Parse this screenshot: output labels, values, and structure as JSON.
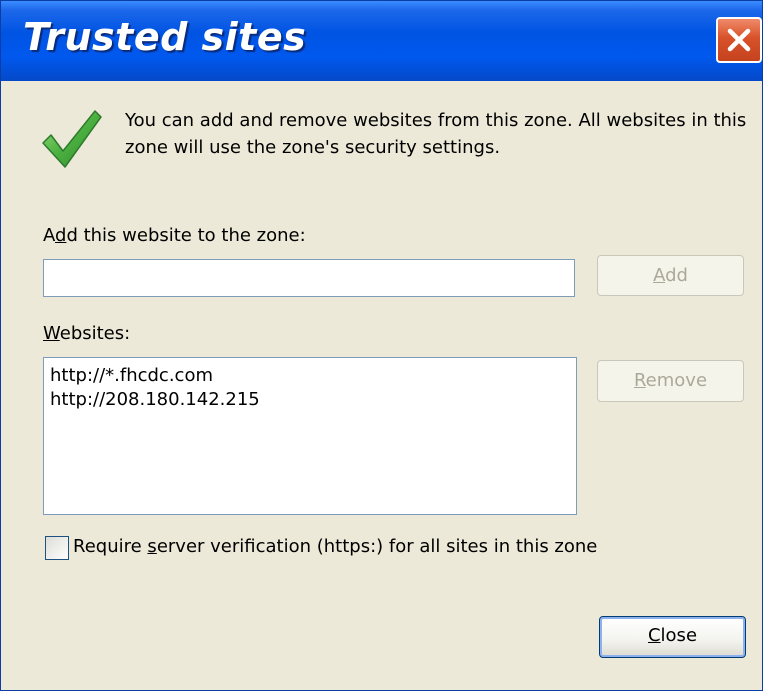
{
  "window": {
    "title": "Trusted sites"
  },
  "intro": {
    "text": "You can add and remove websites from this zone. All websites in this zone will use the zone's security settings."
  },
  "add_section": {
    "label_mnemonic": "d",
    "label_before": "A",
    "label_after": "d this website to the zone:",
    "input_value": "",
    "add_button": {
      "before": "",
      "mnemonic": "A",
      "after": "dd",
      "enabled": false
    }
  },
  "websites": {
    "label_before": "",
    "label_mnemonic": "W",
    "label_after": "ebsites:",
    "items": [
      "http://*.fhcdc.com",
      "http://208.180.142.215"
    ],
    "remove_button": {
      "before": "",
      "mnemonic": "R",
      "after": "emove",
      "enabled": false
    }
  },
  "verification": {
    "checked": false,
    "label_before": "Require ",
    "label_mnemonic": "s",
    "label_after": "erver verification (https:) for all sites in this zone"
  },
  "footer": {
    "close_button": {
      "before": "",
      "mnemonic": "C",
      "after": "lose"
    }
  },
  "colors": {
    "titlebar": "#0054e3",
    "dialog_bg": "#ece9d8",
    "close_x": "#d8522a",
    "check_icon": "#3fa03f",
    "disabled_text": "#aca899"
  },
  "icons": {
    "close": "close-icon",
    "intro": "checkmark-icon"
  }
}
